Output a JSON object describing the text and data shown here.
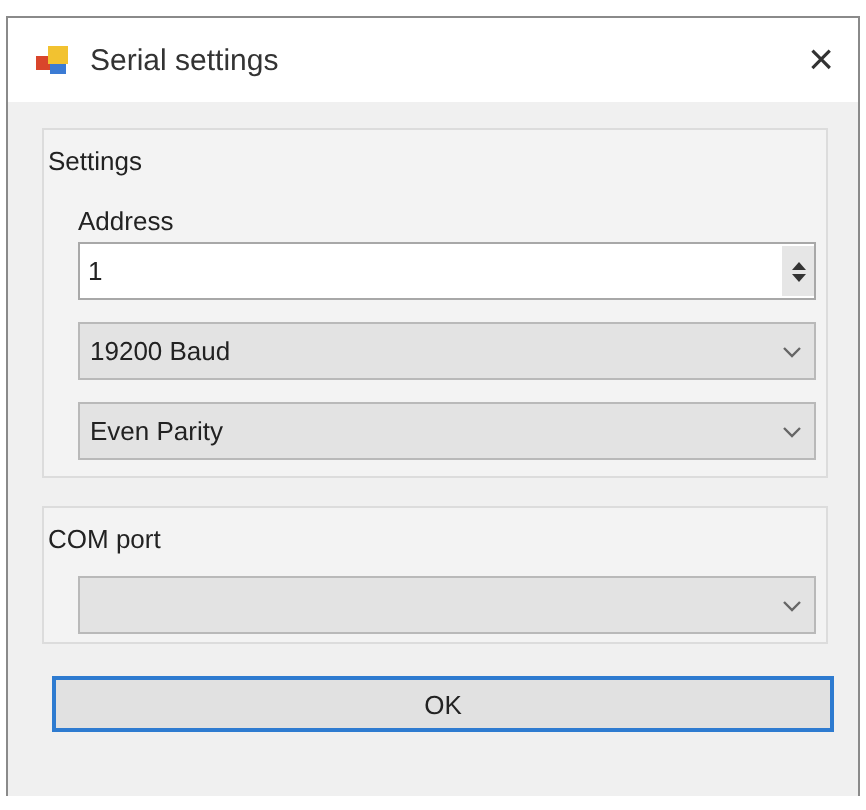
{
  "window": {
    "title": "Serial settings",
    "close": "×"
  },
  "settings_group": {
    "title": "Settings",
    "address_label": "Address",
    "address": {
      "value": "1"
    },
    "combos": [
      {
        "value": "19200 Baud"
      },
      {
        "value": "Even Parity"
      }
    ]
  },
  "com_group": {
    "title": "COM port"
  },
  "buttons": [
    {
      "label": "OK",
      "focused": true
    }
  ]
}
